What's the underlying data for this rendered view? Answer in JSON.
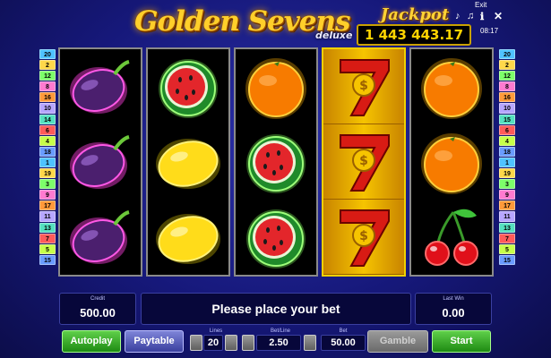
{
  "header": {
    "title": "Golden Sevens",
    "subtitle": "deluxe",
    "jackpot_label": "Jackpot",
    "jackpot_value": "1 443 443.17"
  },
  "top_bar": {
    "exit_label": "Exit",
    "clock": "08:17",
    "icons": [
      "music-note-icon",
      "music-notes-icon",
      "info-icon",
      "close-icon"
    ]
  },
  "line_numbers": {
    "left": [
      "20",
      "2",
      "12",
      "8",
      "16",
      "10",
      "14",
      "6",
      "4",
      "18",
      "1",
      "19",
      "3",
      "9",
      "17",
      "11",
      "13",
      "7",
      "5",
      "15"
    ],
    "right": [
      "20",
      "2",
      "12",
      "8",
      "16",
      "10",
      "15",
      "6",
      "4",
      "18",
      "1",
      "19",
      "3",
      "9",
      "17",
      "11",
      "13",
      "7",
      "5",
      "15"
    ]
  },
  "reels": [
    [
      "plum",
      "plum",
      "plum"
    ],
    [
      "watermelon",
      "lemon",
      "lemon"
    ],
    [
      "orange",
      "watermelon",
      "watermelon"
    ],
    [
      "seven",
      "seven",
      "seven"
    ],
    [
      "orange",
      "orange",
      "cherry"
    ]
  ],
  "panel": {
    "credit_label": "Credit",
    "credit_value": "500.00",
    "message": "Please place your bet",
    "last_win_label": "Last Win",
    "last_win_value": "0.00"
  },
  "controls": {
    "autoplay_label": "Autoplay",
    "paytable_label": "Paytable",
    "lines_label": "Lines",
    "lines_value": "20",
    "bet_line_label": "Bet/Line",
    "bet_line_value": "2.50",
    "bet_label": "Bet",
    "bet_value": "50.00",
    "gamble_label": "Gamble",
    "start_label": "Start"
  },
  "colors": {
    "background": "#16187a",
    "gold": "#ffcf2a",
    "start_green": "#1e8a12",
    "panel": "#07073a"
  }
}
